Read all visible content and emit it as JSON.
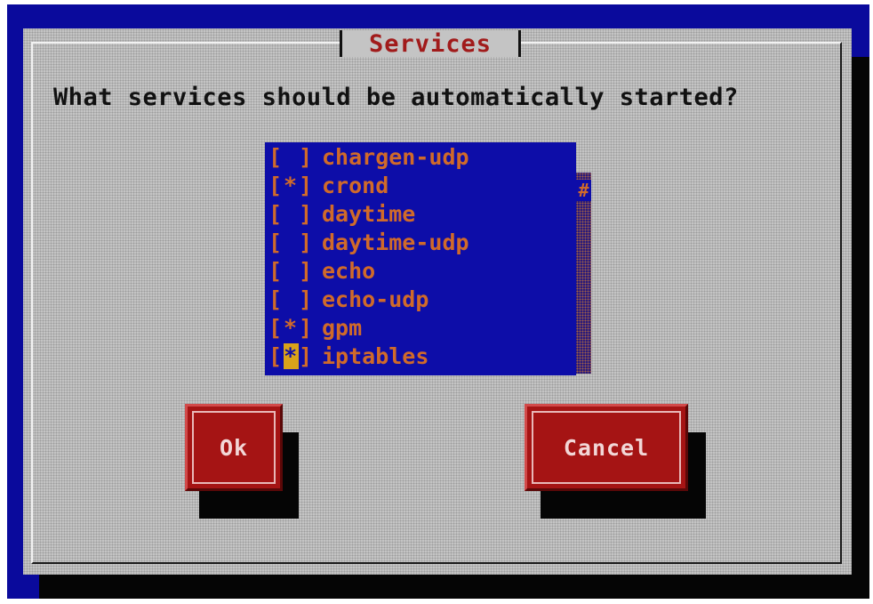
{
  "dialog": {
    "title": "Services",
    "question": "What services should be automatically started?"
  },
  "services": [
    {
      "mark": "[ ]",
      "name": "chargen-udp",
      "checked": false
    },
    {
      "mark": "[*]",
      "name": "crond",
      "checked": true
    },
    {
      "mark": "[ ]",
      "name": "daytime",
      "checked": false
    },
    {
      "mark": "[ ]",
      "name": "daytime-udp",
      "checked": false
    },
    {
      "mark": "[ ]",
      "name": "echo",
      "checked": false
    },
    {
      "mark": "[ ]",
      "name": "echo-udp",
      "checked": false
    },
    {
      "mark": "[*]",
      "name": "gpm",
      "checked": true
    },
    {
      "mark": "[*]",
      "name": "iptables",
      "checked": true,
      "focused": true
    }
  ],
  "scrollbar": {
    "thumb_glyph": "#"
  },
  "buttons": {
    "ok_label": "Ok",
    "cancel_label": "Cancel"
  },
  "colors": {
    "screen_bg": "#0a0a9c",
    "dialog_bg": "#c4c4c4",
    "title_text": "#a11b1b",
    "list_bg": "#0d0da8",
    "list_text": "#d06a2a",
    "button_bg": "#a51414",
    "button_text": "#f2d7d7"
  }
}
